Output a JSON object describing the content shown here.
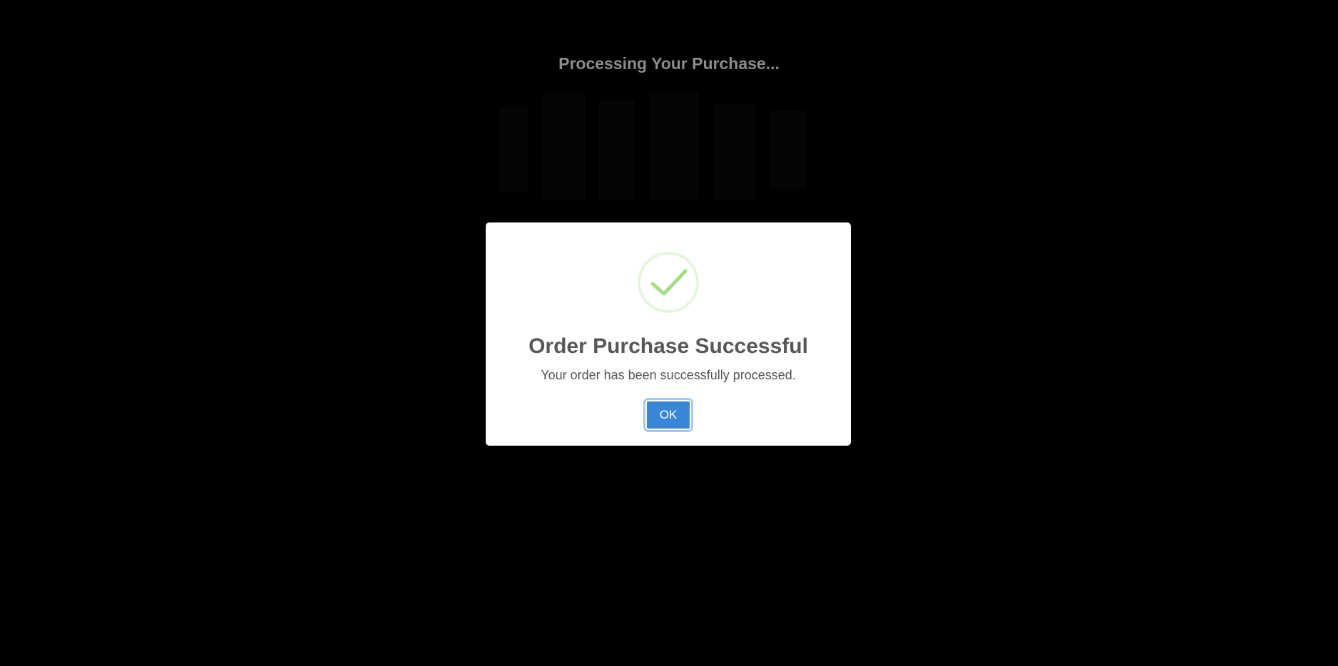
{
  "background": {
    "title": "Processing Your Purchase..."
  },
  "modal": {
    "icon": "checkmark-success-icon",
    "title": "Order Purchase Successful",
    "message": "Your order has been successfully processed.",
    "ok_label": "OK"
  },
  "colors": {
    "backdrop": "#000000",
    "modal_background": "#ffffff",
    "success_green": "#a5dc86",
    "success_ring": "#e6f5dd",
    "button_blue": "#3a86d6"
  }
}
